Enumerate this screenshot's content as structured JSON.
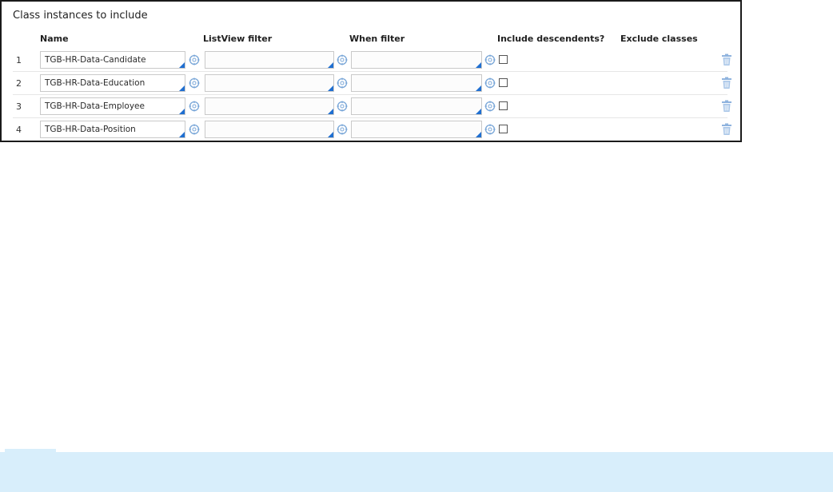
{
  "section": {
    "title": "Class instances to include"
  },
  "columns": {
    "name": "Name",
    "listview_filter": "ListView filter",
    "when_filter": "When filter",
    "include_descendents": "Include descendents?",
    "exclude_classes": "Exclude classes"
  },
  "rows": [
    {
      "num": "1",
      "name": "TGB-HR-Data-Candidate",
      "listview_filter": "",
      "when_filter": "",
      "include_descendents": false
    },
    {
      "num": "2",
      "name": "TGB-HR-Data-Education",
      "listview_filter": "",
      "when_filter": "",
      "include_descendents": false
    },
    {
      "num": "3",
      "name": "TGB-HR-Data-Employee",
      "listview_filter": "",
      "when_filter": "",
      "include_descendents": false
    },
    {
      "num": "4",
      "name": "TGB-HR-Data-Position",
      "listview_filter": "",
      "when_filter": "",
      "include_descendents": false
    }
  ],
  "icons": {
    "picker": "crosshair-picker-icon",
    "delete": "trash-icon",
    "autocomplete": "autocomplete-corner-icon"
  },
  "colors": {
    "accent": "#1f6fd1",
    "icon_blue": "#7aa7d8",
    "info_bar": "#d8eefb"
  }
}
